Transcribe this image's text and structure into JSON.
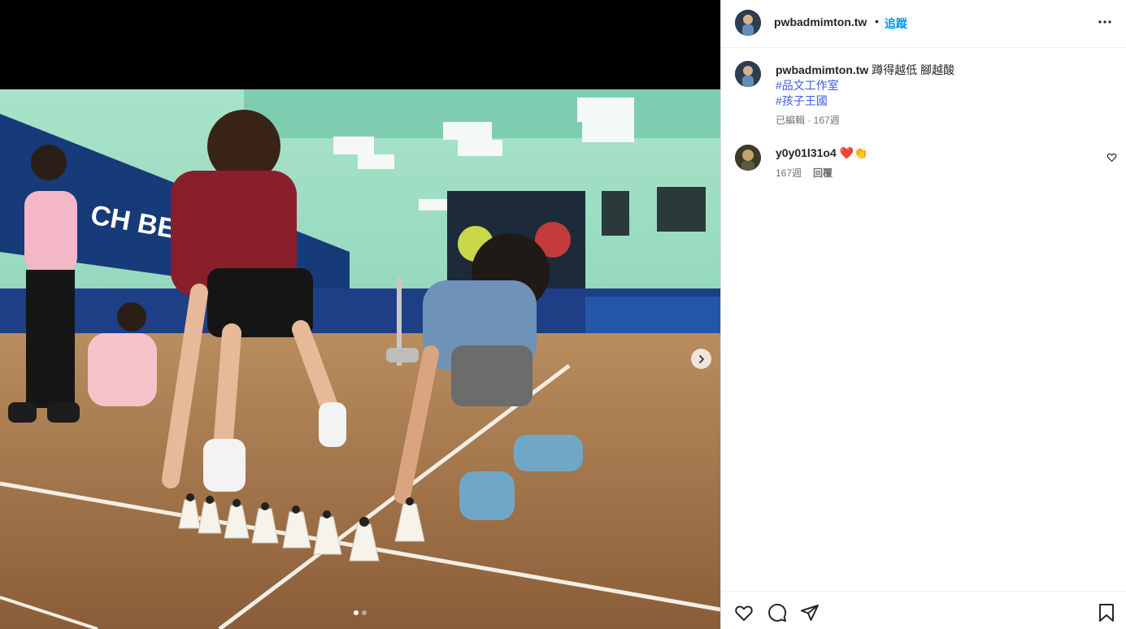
{
  "post": {
    "username": "pwbadmimton.tw",
    "separator": "•",
    "follow_label": "追蹤"
  },
  "caption": {
    "username": "pwbadmimton.tw",
    "text": "蹲得越低 腳越酸",
    "hashtags": [
      "#品文工作室",
      "#孩子王國"
    ],
    "meta": "已編輯 · 167週"
  },
  "comments": [
    {
      "username": "y0y01l31o4",
      "text": "❤️👏",
      "time": "167週",
      "reply_label": "回覆"
    }
  ],
  "carousel": {
    "current": 1,
    "total": 2
  },
  "icons": {
    "more": "more-options-icon",
    "next": "chevron-right-icon",
    "like": "heart-icon",
    "comment": "comment-icon",
    "share": "send-icon",
    "save": "bookmark-icon"
  },
  "colors": {
    "follow": "#0095f6",
    "hashtag": "#00376b",
    "muted": "#737373"
  }
}
